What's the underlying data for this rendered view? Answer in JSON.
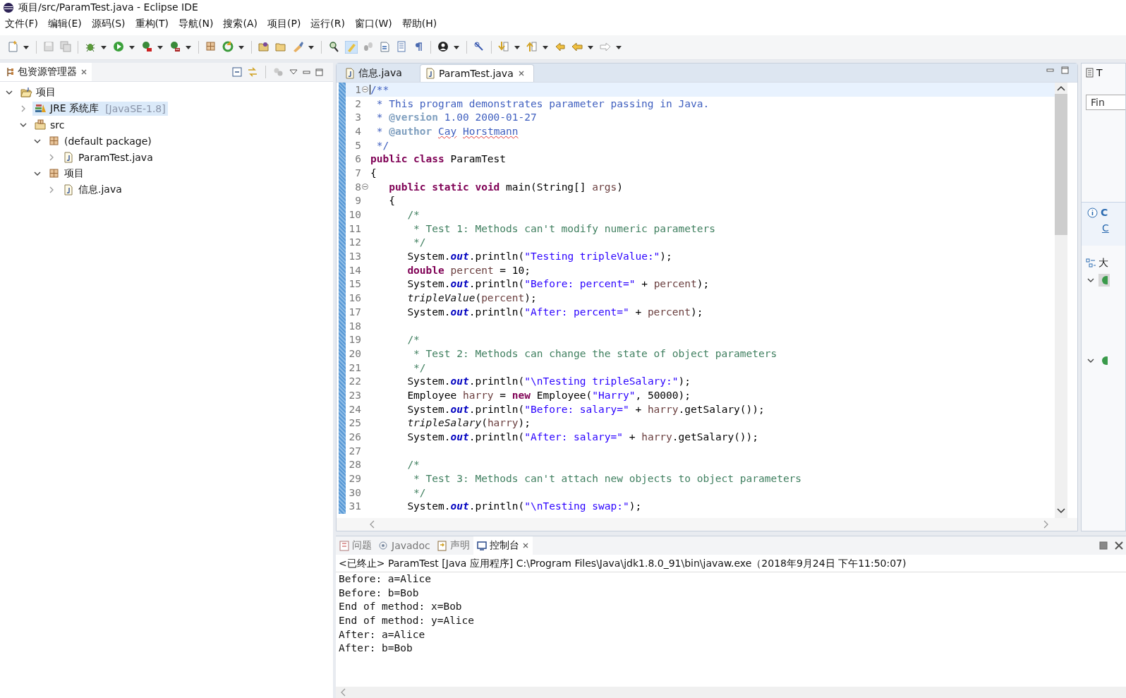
{
  "window": {
    "title": "项目/src/ParamTest.java - Eclipse IDE"
  },
  "menu": [
    "文件(F)",
    "编辑(E)",
    "源码(S)",
    "重构(T)",
    "导航(N)",
    "搜索(A)",
    "项目(P)",
    "运行(R)",
    "窗口(W)",
    "帮助(H)"
  ],
  "package_explorer": {
    "title": "包资源管理器",
    "tree": [
      {
        "label": "项目",
        "kind": "project",
        "expanded": true,
        "selected": false,
        "children": [
          {
            "label": "JRE 系统库",
            "decoration": "[JavaSE-1.8]",
            "kind": "library",
            "expanded": false,
            "selected": true
          },
          {
            "label": "src",
            "kind": "source-folder",
            "expanded": true,
            "selected": false,
            "children": [
              {
                "label": "(default package)",
                "kind": "package",
                "expanded": true,
                "selected": false,
                "children": [
                  {
                    "label": "ParamTest.java",
                    "kind": "java-file",
                    "expanded": false,
                    "selected": false
                  }
                ]
              },
              {
                "label": "项目",
                "kind": "package",
                "expanded": true,
                "selected": false,
                "children": [
                  {
                    "label": "信息.java",
                    "kind": "java-file",
                    "expanded": false,
                    "selected": false
                  }
                ]
              }
            ]
          }
        ]
      }
    ]
  },
  "editor": {
    "tabs": [
      {
        "label": "信息.java",
        "selected": false
      },
      {
        "label": "ParamTest.java",
        "selected": true
      }
    ],
    "lines": [
      {
        "no": "1",
        "fold": true,
        "current": true,
        "tokens": [
          {
            "kind": "doc",
            "text": "/**"
          }
        ]
      },
      {
        "no": "2",
        "fold": false,
        "current": false,
        "tokens": [
          {
            "kind": "doc",
            "text": " * This program demonstrates parameter passing in Java."
          }
        ]
      },
      {
        "no": "3",
        "fold": false,
        "current": false,
        "tokens": [
          {
            "kind": "doc",
            "text": " * "
          },
          {
            "kind": "tag",
            "text": "@version"
          },
          {
            "kind": "doc",
            "text": " 1.00 2000-01-27"
          }
        ]
      },
      {
        "no": "4",
        "fold": false,
        "current": false,
        "tokens": [
          {
            "kind": "doc",
            "text": " * "
          },
          {
            "kind": "tag",
            "text": "@author "
          },
          {
            "kind": "spell",
            "text": "Cay"
          },
          {
            "kind": "spell",
            "text": " Horstmann"
          }
        ]
      },
      {
        "no": "5",
        "fold": false,
        "current": false,
        "tokens": [
          {
            "kind": "doc",
            "text": " */"
          }
        ]
      },
      {
        "no": "6",
        "fold": false,
        "current": false,
        "tokens": [
          {
            "kind": "kw",
            "text": "public "
          },
          {
            "kind": "kw",
            "text": "class"
          },
          {
            "kind": "plain",
            "text": " ParamTest"
          }
        ]
      },
      {
        "no": "7",
        "fold": false,
        "current": false,
        "tokens": [
          {
            "kind": "plain",
            "text": "{"
          }
        ]
      },
      {
        "no": "8",
        "fold": true,
        "current": false,
        "tokens": [
          {
            "kind": "kw",
            "text": "   public "
          },
          {
            "kind": "kw",
            "text": "static "
          },
          {
            "kind": "kw",
            "text": "void"
          },
          {
            "kind": "plain",
            "text": " main(String[] "
          },
          {
            "kind": "local",
            "text": "args"
          },
          {
            "kind": "plain",
            "text": ")"
          }
        ]
      },
      {
        "no": "9",
        "fold": false,
        "current": false,
        "tokens": [
          {
            "kind": "plain",
            "text": "   {"
          }
        ]
      },
      {
        "no": "10",
        "fold": false,
        "current": false,
        "tokens": [
          {
            "kind": "cm",
            "text": "      /*"
          }
        ]
      },
      {
        "no": "11",
        "fold": false,
        "current": false,
        "tokens": [
          {
            "kind": "cm",
            "text": "       * Test 1: Methods can't modify numeric parameters"
          }
        ]
      },
      {
        "no": "12",
        "fold": false,
        "current": false,
        "tokens": [
          {
            "kind": "cm",
            "text": "       */"
          }
        ]
      },
      {
        "no": "13",
        "fold": false,
        "current": false,
        "tokens": [
          {
            "kind": "plain",
            "text": "      System."
          },
          {
            "kind": "field",
            "text": "out"
          },
          {
            "kind": "plain",
            "text": ".println("
          },
          {
            "kind": "str",
            "text": "\"Testing tripleValue:\""
          },
          {
            "kind": "plain",
            "text": ");"
          }
        ]
      },
      {
        "no": "14",
        "fold": false,
        "current": false,
        "tokens": [
          {
            "kind": "kw",
            "text": "      double "
          },
          {
            "kind": "local",
            "text": "percent"
          },
          {
            "kind": "plain",
            "text": " = 10;"
          }
        ]
      },
      {
        "no": "15",
        "fold": false,
        "current": false,
        "tokens": [
          {
            "kind": "plain",
            "text": "      System."
          },
          {
            "kind": "field",
            "text": "out"
          },
          {
            "kind": "plain",
            "text": ".println("
          },
          {
            "kind": "str",
            "text": "\"Before: percent=\""
          },
          {
            "kind": "plain",
            "text": " + "
          },
          {
            "kind": "local",
            "text": "percent"
          },
          {
            "kind": "plain",
            "text": ");"
          }
        ]
      },
      {
        "no": "16",
        "fold": false,
        "current": false,
        "tokens": [
          {
            "kind": "static",
            "text": "      tripleValue"
          },
          {
            "kind": "plain",
            "text": "("
          },
          {
            "kind": "local",
            "text": "percent"
          },
          {
            "kind": "plain",
            "text": ");"
          }
        ]
      },
      {
        "no": "17",
        "fold": false,
        "current": false,
        "tokens": [
          {
            "kind": "plain",
            "text": "      System."
          },
          {
            "kind": "field",
            "text": "out"
          },
          {
            "kind": "plain",
            "text": ".println("
          },
          {
            "kind": "str",
            "text": "\"After: percent=\""
          },
          {
            "kind": "plain",
            "text": " + "
          },
          {
            "kind": "local",
            "text": "percent"
          },
          {
            "kind": "plain",
            "text": ");"
          }
        ]
      },
      {
        "no": "18",
        "fold": false,
        "current": false
      },
      {
        "no": "19",
        "fold": false,
        "current": false,
        "tokens": [
          {
            "kind": "cm",
            "text": "      /*"
          }
        ]
      },
      {
        "no": "20",
        "fold": false,
        "current": false,
        "tokens": [
          {
            "kind": "cm",
            "text": "       * Test 2: Methods can change the state of object parameters"
          }
        ]
      },
      {
        "no": "21",
        "fold": false,
        "current": false,
        "tokens": [
          {
            "kind": "cm",
            "text": "       */"
          }
        ]
      },
      {
        "no": "22",
        "fold": false,
        "current": false,
        "tokens": [
          {
            "kind": "plain",
            "text": "      System."
          },
          {
            "kind": "field",
            "text": "out"
          },
          {
            "kind": "plain",
            "text": ".println("
          },
          {
            "kind": "str",
            "text": "\"\\nTesting tripleSalary:\""
          },
          {
            "kind": "plain",
            "text": ");"
          }
        ]
      },
      {
        "no": "23",
        "fold": false,
        "current": false,
        "tokens": [
          {
            "kind": "plain",
            "text": "      Employee "
          },
          {
            "kind": "local",
            "text": "harry"
          },
          {
            "kind": "plain",
            "text": " = "
          },
          {
            "kind": "kw",
            "text": "new"
          },
          {
            "kind": "plain",
            "text": " Employee("
          },
          {
            "kind": "str",
            "text": "\"Harry\""
          },
          {
            "kind": "plain",
            "text": ", 50000);"
          }
        ]
      },
      {
        "no": "24",
        "fold": false,
        "current": false,
        "tokens": [
          {
            "kind": "plain",
            "text": "      System."
          },
          {
            "kind": "field",
            "text": "out"
          },
          {
            "kind": "plain",
            "text": ".println("
          },
          {
            "kind": "str",
            "text": "\"Before: salary=\""
          },
          {
            "kind": "plain",
            "text": " + "
          },
          {
            "kind": "local",
            "text": "harry"
          },
          {
            "kind": "plain",
            "text": ".getSalary());"
          }
        ]
      },
      {
        "no": "25",
        "fold": false,
        "current": false,
        "tokens": [
          {
            "kind": "static",
            "text": "      tripleSalary"
          },
          {
            "kind": "plain",
            "text": "("
          },
          {
            "kind": "local",
            "text": "harry"
          },
          {
            "kind": "plain",
            "text": ");"
          }
        ]
      },
      {
        "no": "26",
        "fold": false,
        "current": false,
        "tokens": [
          {
            "kind": "plain",
            "text": "      System."
          },
          {
            "kind": "field",
            "text": "out"
          },
          {
            "kind": "plain",
            "text": ".println("
          },
          {
            "kind": "str",
            "text": "\"After: salary=\""
          },
          {
            "kind": "plain",
            "text": " + "
          },
          {
            "kind": "local",
            "text": "harry"
          },
          {
            "kind": "plain",
            "text": ".getSalary());"
          }
        ]
      },
      {
        "no": "27",
        "fold": false,
        "current": false
      },
      {
        "no": "28",
        "fold": false,
        "current": false,
        "tokens": [
          {
            "kind": "cm",
            "text": "      /*"
          }
        ]
      },
      {
        "no": "29",
        "fold": false,
        "current": false,
        "tokens": [
          {
            "kind": "cm",
            "text": "       * Test 3: Methods can't attach new objects to object parameters"
          }
        ]
      },
      {
        "no": "30",
        "fold": false,
        "current": false,
        "tokens": [
          {
            "kind": "cm",
            "text": "       */"
          }
        ]
      },
      {
        "no": "31",
        "fold": false,
        "current": false,
        "tokens": [
          {
            "kind": "plain",
            "text": "      System."
          },
          {
            "kind": "field",
            "text": "out"
          },
          {
            "kind": "plain",
            "text": ".println("
          },
          {
            "kind": "str",
            "text": "\"\\nTesting swap:\""
          },
          {
            "kind": "plain",
            "text": ");"
          }
        ]
      }
    ]
  },
  "side_panel": {
    "title": "T",
    "find_placeholder": "Fin",
    "info_title": "C",
    "info_link": "C",
    "outline_title": "大",
    "outline_items": [
      {
        "expanded": true,
        "selected": true
      },
      {
        "expanded": true,
        "selected": false
      }
    ]
  },
  "console": {
    "tabs": [
      {
        "label": "问题",
        "kind": "problems",
        "selected": false
      },
      {
        "label": "Javadoc",
        "kind": "javadoc",
        "selected": false
      },
      {
        "label": "声明",
        "kind": "declaration",
        "selected": false
      },
      {
        "label": "控制台",
        "kind": "console",
        "selected": true
      }
    ],
    "header": "<已终止> ParamTest [Java 应用程序] C:\\Program Files\\Java\\jdk1.8.0_91\\bin\\javaw.exe（2018年9月24日 下午11:50:07)",
    "output": [
      "Before: a=Alice",
      "Before: b=Bob",
      "End of method: x=Bob",
      "End of method: y=Alice",
      "After: a=Alice",
      "After: b=Bob"
    ]
  }
}
